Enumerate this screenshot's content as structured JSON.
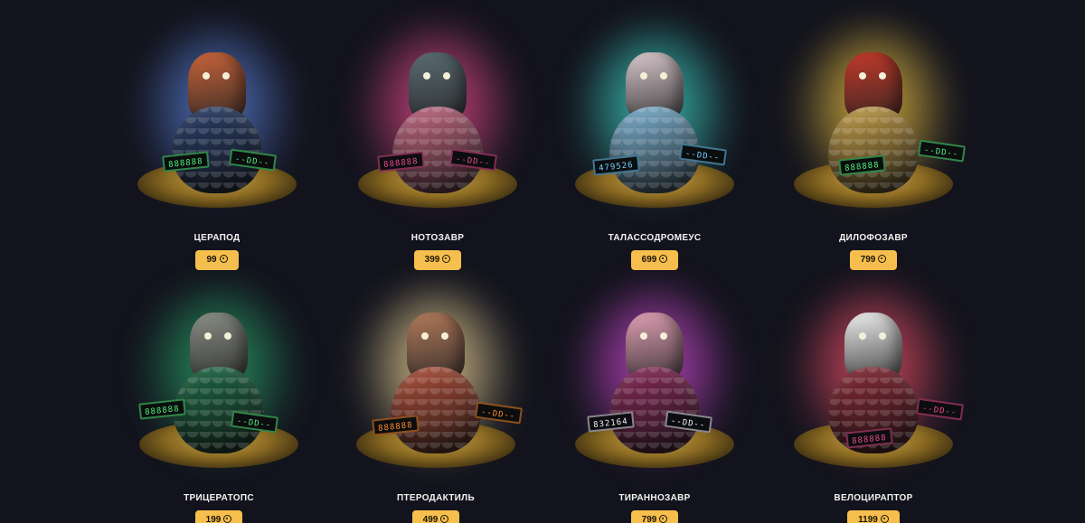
{
  "cases": [
    {
      "name": "ЦЕРАПОД",
      "price": "99",
      "glow": "#5a7fd6",
      "egg": "#2a3f6a",
      "creature": "#c7643a",
      "counter_left": "888888",
      "counter_right": "--DD--",
      "counter_color": "#4ef07a"
    },
    {
      "name": "НОТОЗАВР",
      "price": "399",
      "glow": "#e84a8c",
      "egg": "#c86a86",
      "creature": "#5b6c74",
      "counter_left": "888888",
      "counter_right": "--DD--",
      "counter_color": "#e84a8c"
    },
    {
      "name": "ТАЛАССОДРОМЕУС",
      "price": "699",
      "glow": "#3fd6c9",
      "egg": "#7fb6d8",
      "creature": "#d8c8cc",
      "counter_left": "479526",
      "counter_right": "--DD--",
      "counter_color": "#6fd2ff"
    },
    {
      "name": "ДИЛОФОЗАВР",
      "price": "799",
      "glow": "#f0c443",
      "egg": "#c9a24a",
      "creature": "#c23a2a",
      "counter_left": "888888",
      "counter_right": "--DD--",
      "counter_color": "#4ef07a"
    },
    {
      "name": "ТРИЦЕРАТОПС",
      "price": "199",
      "glow": "#2aa36a",
      "egg": "#1d6a45",
      "creature": "#8a8f86",
      "counter_left": "888888",
      "counter_right": "--DD--",
      "counter_color": "#4ef07a"
    },
    {
      "name": "ПТЕРОДАКТИЛЬ",
      "price": "499",
      "glow": "#f2d99a",
      "egg": "#b2503a",
      "creature": "#b27a5a",
      "counter_left": "888888",
      "counter_right": "--DD--",
      "counter_color": "#ff8a2a"
    },
    {
      "name": "ТИРАННОЗАВР",
      "price": "799",
      "glow": "#d24ad6",
      "egg": "#8a2a5a",
      "creature": "#e0a0b4",
      "counter_left": "832164",
      "counter_right": "--DD--",
      "counter_color": "#f4f0ff"
    },
    {
      "name": "ВЕЛОЦИРАПТОР",
      "price": "1199",
      "glow": "#f0506a",
      "egg": "#8a2a36",
      "creature": "#eeeeee",
      "counter_left": "888888",
      "counter_right": "--DD--",
      "counter_color": "#e84a8c"
    }
  ]
}
